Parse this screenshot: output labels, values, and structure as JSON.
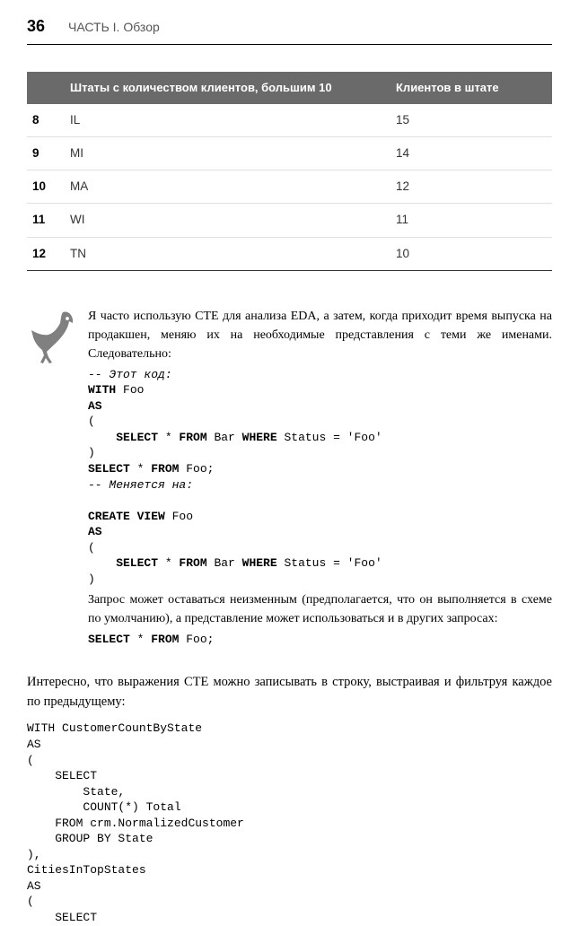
{
  "header": {
    "page_number": "36",
    "section_title": "ЧАСТЬ I. Обзор"
  },
  "chart_data": {
    "type": "table",
    "columns": [
      "",
      "Штаты с количеством клиентов, большим 10",
      "Клиентов в штате"
    ],
    "rows": [
      {
        "n": "8",
        "state": "IL",
        "count": "15"
      },
      {
        "n": "9",
        "state": "MI",
        "count": "14"
      },
      {
        "n": "10",
        "state": "MA",
        "count": "12"
      },
      {
        "n": "11",
        "state": "WI",
        "count": "11"
      },
      {
        "n": "12",
        "state": "TN",
        "count": "10"
      }
    ]
  },
  "note": {
    "p1": "Я часто использую CTE для анализа EDA, а затем, когда приходит время выпуска на продакшен, меняю их на необходимые представления с теми же именами. Следовательно:",
    "code1_comment": "-- Этот код:",
    "code1_l2": "WITH",
    "code1_l2b": " Foo",
    "code1_l3": "AS",
    "code1_l4": "(",
    "code1_l5a": "    SELECT",
    "code1_l5b": " * ",
    "code1_l5c": "FROM",
    "code1_l5d": " Bar ",
    "code1_l5e": "WHERE",
    "code1_l5f": " Status = 'Foo'",
    "code1_l6": ")",
    "code1_l7a": "SELECT",
    "code1_l7b": " * ",
    "code1_l7c": "FROM",
    "code1_l7d": " Foo;",
    "code1_comment2": "-- Меняется на:",
    "code2_l1a": "CREATE VIEW",
    "code2_l1b": " Foo",
    "code2_l2": "AS",
    "code2_l3": "(",
    "code2_l4a": "    SELECT",
    "code2_l4b": " * ",
    "code2_l4c": "FROM",
    "code2_l4d": " Bar ",
    "code2_l4e": "WHERE",
    "code2_l4f": " Status = 'Foo'",
    "code2_l5": ")",
    "p2": "Запрос может оставаться неизменным (предполагается, что он выполняется в схеме по умолчанию), а представление может использоваться и в других запросах:",
    "code3_a": "SELECT",
    "code3_b": " * ",
    "code3_c": "FROM",
    "code3_d": " Foo;"
  },
  "body": {
    "p1": "Интересно, что выражения CTE можно записывать в строку, выстраивая и фильтруя каждое по предыдущему:"
  },
  "final": {
    "l1a": "WITH",
    "l1b": " CustomerCountByState",
    "l2": "AS",
    "l3": "(",
    "l4": "    SELECT",
    "l5": "        State,",
    "l6a": "        COUNT",
    "l6b": "(*) Total",
    "l7a": "    FROM",
    "l7b": " crm.NormalizedCustomer",
    "l8a": "    GROUP BY",
    "l8b": " State",
    "l9": "),",
    "l10": "CitiesInTopStates",
    "l11": "AS",
    "l12": "(",
    "l13": "    SELECT"
  }
}
